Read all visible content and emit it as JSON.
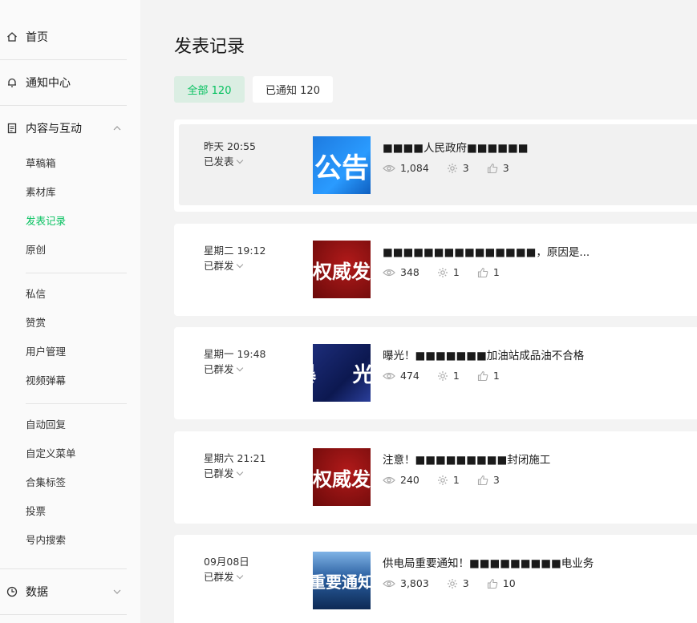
{
  "sidebar": {
    "home": "首页",
    "notifications": "通知中心",
    "content_section": "内容与互动",
    "content_items": [
      "草稿箱",
      "素材库",
      "发表记录",
      "原创"
    ],
    "interaction_items": [
      "私信",
      "赞赏",
      "用户管理",
      "视频弹幕"
    ],
    "feature_items": [
      "自动回复",
      "自定义菜单",
      "合集标签",
      "投票",
      "号内搜索"
    ],
    "data_section": "数据",
    "active_item": "发表记录"
  },
  "main": {
    "title": "发表记录",
    "filters": {
      "all": "全部 120",
      "notified": "已通知 120"
    },
    "posts": [
      {
        "date": "昨天 20:55",
        "status": "已发表",
        "thumb_text": "公告",
        "title": "■■■■人民政府■■■■■■",
        "views": "1,084",
        "shares": "3",
        "likes": "3"
      },
      {
        "date": "星期二 19:12",
        "status": "已群发",
        "thumb_text": "权威发布",
        "title": "■■■■■■■■■■■■■■■，原因是...",
        "views": "348",
        "shares": "1",
        "likes": "1"
      },
      {
        "date": "星期一 19:48",
        "status": "已群发",
        "thumb_text": "暴 光",
        "title": "曝光！■■■■■■■加油站成品油不合格",
        "views": "474",
        "shares": "1",
        "likes": "1"
      },
      {
        "date": "星期六 21:21",
        "status": "已群发",
        "thumb_text": "权威发布",
        "title": "注意！■■■■■■■■■封闭施工",
        "views": "240",
        "shares": "1",
        "likes": "3"
      },
      {
        "date": "09月08日",
        "status": "已群发",
        "thumb_text": "重要通知",
        "title": "供电局重要通知！■■■■■■■■■电业务",
        "views": "3,803",
        "shares": "3",
        "likes": "10"
      }
    ]
  },
  "colors": {
    "accent": "#07c160",
    "accent_bg": "#dbeee3",
    "page_bg": "#f3f3f3"
  },
  "icons": {
    "home": "home-icon",
    "notifications": "bell-icon",
    "content": "document-icon",
    "data": "clock-icon",
    "views": "eye-icon",
    "shares": "gear-icon",
    "likes": "thumbs-up-icon"
  }
}
